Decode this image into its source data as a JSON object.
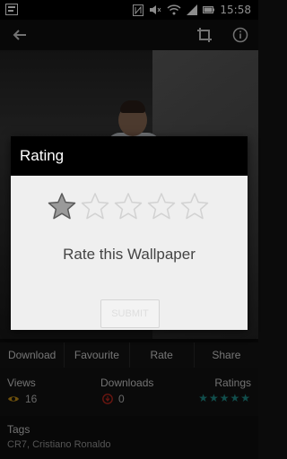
{
  "status_bar": {
    "time": "15:58",
    "icons": [
      "notification-icon",
      "nfc-icon",
      "mute-icon",
      "wifi-icon",
      "cell-signal-icon",
      "battery-icon"
    ]
  },
  "toolbar": {
    "icons": [
      "back-arrow-icon",
      "crop-icon",
      "info-icon"
    ]
  },
  "actions": [
    "Download",
    "Favourite",
    "Rate",
    "Share"
  ],
  "stats": {
    "views_label": "Views",
    "views_value": "16",
    "downloads_label": "Downloads",
    "downloads_value": "0",
    "ratings_label": "Ratings",
    "ratings_stars": "★★★★★"
  },
  "tags": {
    "label": "Tags",
    "value": "CR7, Cristiano Ronaldo"
  },
  "dialog": {
    "title": "Rating",
    "caption": "Rate this Wallpaper",
    "submit_label": "SUBMIT",
    "rating_value": 1,
    "rating_max": 5
  },
  "colors": {
    "accent": "#1f8f8a",
    "dialog_bg": "#efefef",
    "header_bg": "#000000"
  }
}
